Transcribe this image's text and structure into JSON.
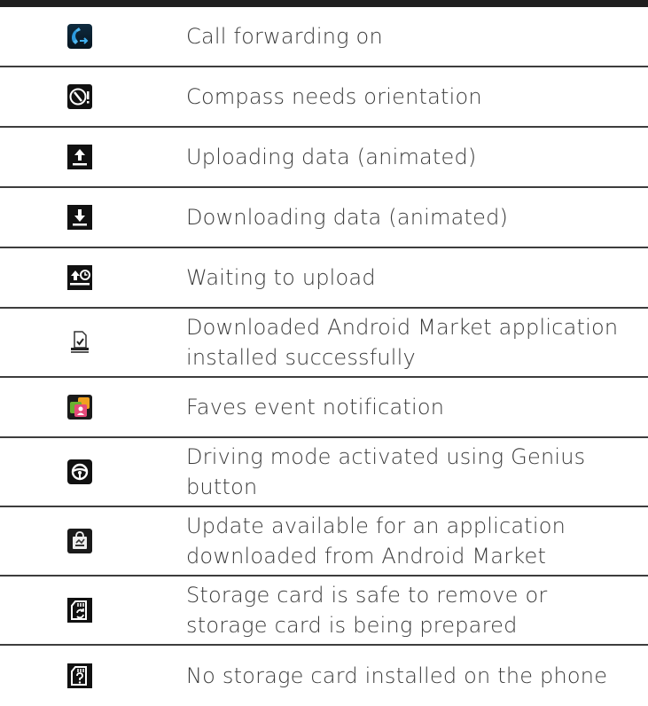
{
  "rows": [
    {
      "icon": "call-forwarding-icon",
      "lines": [
        "Call forwarding on"
      ]
    },
    {
      "icon": "compass-warning-icon",
      "lines": [
        "Compass needs orientation"
      ]
    },
    {
      "icon": "upload-icon",
      "lines": [
        "Uploading data (animated)"
      ]
    },
    {
      "icon": "download-icon",
      "lines": [
        "Downloading data (animated)"
      ]
    },
    {
      "icon": "waiting-upload-icon",
      "lines": [
        "Waiting to upload"
      ]
    },
    {
      "icon": "market-installed-icon",
      "lines": [
        "Downloaded Android Market application",
        "installed successfully"
      ]
    },
    {
      "icon": "faves-event-icon",
      "lines": [
        "Faves event notification"
      ]
    },
    {
      "icon": "driving-mode-icon",
      "lines": [
        "Driving mode activated using Genius",
        "button"
      ]
    },
    {
      "icon": "market-update-icon",
      "lines": [
        "Update available for an application",
        "downloaded from Android Market"
      ]
    },
    {
      "icon": "storage-card-safe-icon",
      "lines": [
        "Storage card is safe to remove or",
        "storage card is being prepared"
      ]
    },
    {
      "icon": "no-storage-card-icon",
      "lines": [
        "No storage card installed on the phone"
      ]
    }
  ]
}
